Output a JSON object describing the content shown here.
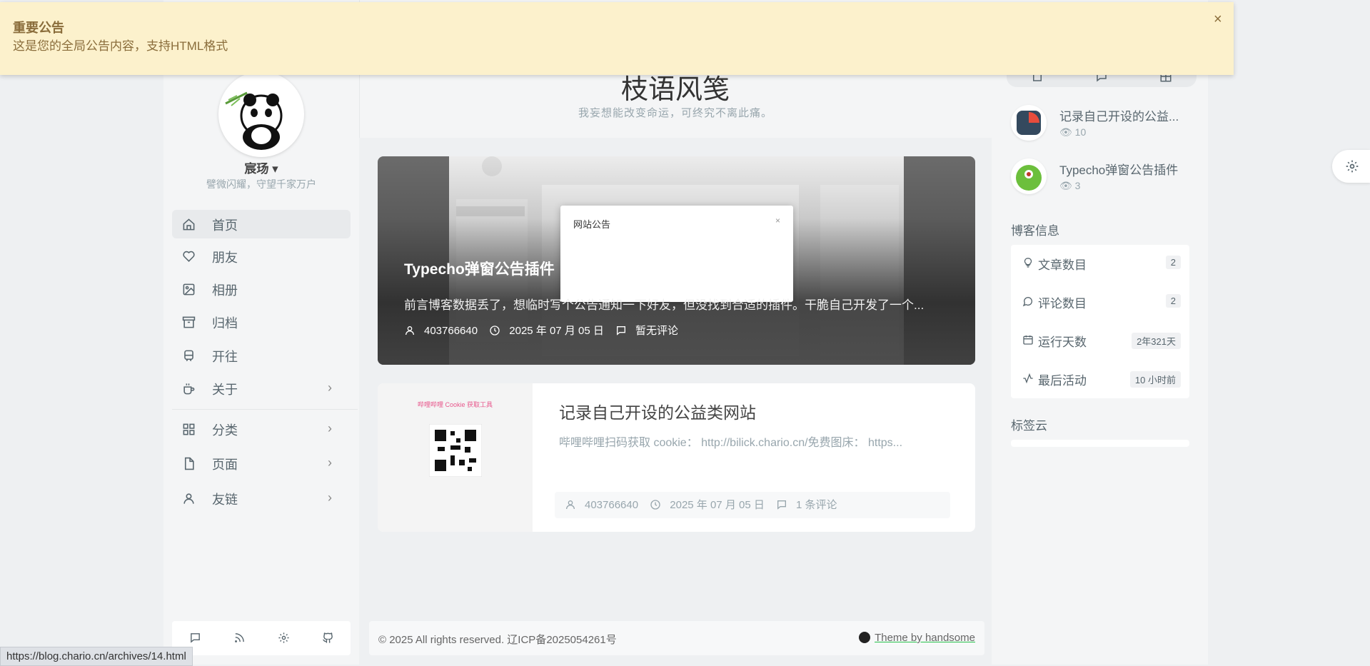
{
  "notice": {
    "title": "重要公告",
    "body": "这是您的全局公告内容，支持HTML格式",
    "close": "×"
  },
  "site": {
    "title": "枝语风笺",
    "subtitle": "我妄想能改变命运，可终究不离此痛。"
  },
  "profile": {
    "name": "宸玚 ▾",
    "motto": "譬微闪耀，守望千家万户"
  },
  "nav": [
    {
      "label": "首页",
      "icon": "home-icon"
    },
    {
      "label": "朋友",
      "icon": "heart-icon"
    },
    {
      "label": "相册",
      "icon": "image-icon"
    },
    {
      "label": "归档",
      "icon": "archive-icon"
    },
    {
      "label": "开往",
      "icon": "train-icon"
    },
    {
      "label": "关于",
      "icon": "coffee-icon",
      "chevron": "›"
    },
    {
      "label": "分类",
      "icon": "grid-icon",
      "chevron": "›"
    },
    {
      "label": "页面",
      "icon": "file-icon",
      "chevron": "›"
    },
    {
      "label": "友链",
      "icon": "user-icon",
      "chevron": "›"
    }
  ],
  "posts": [
    {
      "title": "Typecho弹窗公告插件",
      "excerpt": "前言博客数据丢了，想临时写个公告通知一下好友，但没找到合适的插件。干脆自己开发了一个...",
      "author": "403766640",
      "date": "2025 年 07 月 05 日",
      "comments": "暂无评论",
      "popup_title": "网站公告",
      "popup_close": "×"
    },
    {
      "title": "记录自己开设的公益类网站",
      "excerpt": "哔哩哔哩扫码获取 cookie： http://bilick.chario.cn/免费图床： https...",
      "author": "403766640",
      "date": "2025 年 07 月 05 日",
      "comments": "1 条评论",
      "thumb_text": "哔哩哔哩 Cookie 获取工具"
    }
  ],
  "footer": {
    "copyright": "© 2025 All rights reserved. 辽ICP备2025054261号",
    "theme": "Theme by handsome"
  },
  "sidebar_right": {
    "hot_posts": [
      {
        "title": "记录自己开设的公益...",
        "views": "10"
      },
      {
        "title": "Typecho弹窗公告插件",
        "views": "3"
      }
    ],
    "blog_info_title": "博客信息",
    "blog_info": [
      {
        "label": "文章数目",
        "value": "2",
        "icon": "bulb-icon"
      },
      {
        "label": "评论数目",
        "value": "2",
        "icon": "comment-icon"
      },
      {
        "label": "运行天数",
        "value": "2年321天",
        "icon": "calendar-icon"
      },
      {
        "label": "最后活动",
        "value": "10 小时前",
        "icon": "activity-icon"
      }
    ],
    "tag_cloud_title": "标签云"
  },
  "status_url": "https://blog.chario.cn/archives/14.html"
}
